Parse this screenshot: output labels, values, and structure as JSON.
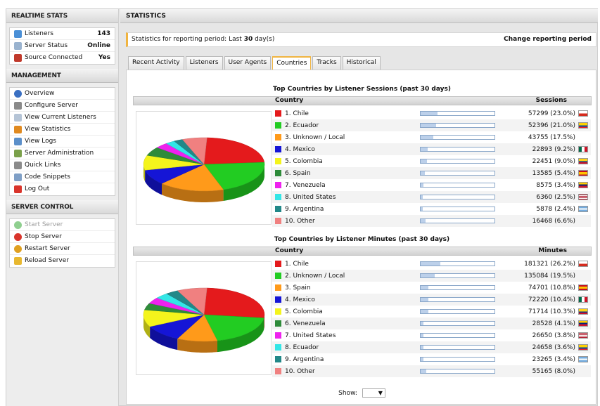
{
  "left": {
    "realtime": {
      "title": "REALTIME STATS",
      "rows": [
        {
          "label": "Listeners",
          "value": "143",
          "icon": "users-icon",
          "color": "#4a8fd6"
        },
        {
          "label": "Server Status",
          "value": "Online",
          "icon": "server-status-icon",
          "color": "#9ab3cf"
        },
        {
          "label": "Source Connected",
          "value": "Yes",
          "icon": "speaker-icon",
          "color": "#c0392b"
        }
      ]
    },
    "management": {
      "title": "MANAGEMENT",
      "items": [
        {
          "label": "Overview",
          "icon": "info-icon",
          "color": "#3a6fc2"
        },
        {
          "label": "Configure Server",
          "icon": "gear-icon",
          "color": "#8a8a8a"
        },
        {
          "label": "View Current Listeners",
          "icon": "document-icon",
          "color": "#b5c4d6"
        },
        {
          "label": "View Statistics",
          "icon": "pie-chart-icon",
          "color": "#e08a20"
        },
        {
          "label": "View Logs",
          "icon": "log-magnifier-icon",
          "color": "#5b8fc9"
        },
        {
          "label": "Server Administration",
          "icon": "admin-icon",
          "color": "#7aa04a"
        },
        {
          "label": "Quick Links",
          "icon": "links-icon",
          "color": "#8b8b8b"
        },
        {
          "label": "Code Snippets",
          "icon": "snippet-icon",
          "color": "#7f9fc6"
        },
        {
          "label": "Log Out",
          "icon": "logout-x-icon",
          "color": "#d9342b"
        }
      ]
    },
    "control": {
      "title": "SERVER CONTROL",
      "items": [
        {
          "label": "Start Server",
          "icon": "play-icon",
          "color": "#8fcf8f",
          "disabled": true
        },
        {
          "label": "Stop Server",
          "icon": "stop-icon",
          "color": "#d9342b"
        },
        {
          "label": "Restart Server",
          "icon": "restart-icon",
          "color": "#e0a020"
        },
        {
          "label": "Reload Server",
          "icon": "reload-lightning-icon",
          "color": "#e8b830"
        }
      ]
    }
  },
  "main": {
    "title": "STATISTICS",
    "period": {
      "prefix": "Statistics for reporting period: Last ",
      "days": "30",
      "suffix": " day(s)",
      "change": "Change reporting period"
    },
    "tabs": [
      "Recent Activity",
      "Listeners",
      "User Agents",
      "Countries",
      "Tracks",
      "Historical"
    ],
    "active_tab": "Countries",
    "sessions": {
      "title": "Top Countries by Listener Sessions (past 30 days)",
      "col_country": "Country",
      "col_value": "Sessions",
      "rows": [
        {
          "name": "1. Chile",
          "value": "57299 (23.0%)",
          "pct": 23.0,
          "color": "#e41a1c",
          "flag": "chile"
        },
        {
          "name": "2. Ecuador",
          "value": "52396 (21.0%)",
          "pct": 21.0,
          "color": "#22cc22",
          "flag": "ecuador"
        },
        {
          "name": "3. Unknown / Local",
          "value": "43755 (17.5%)",
          "pct": 17.5,
          "color": "#ff9a1a",
          "flag": ""
        },
        {
          "name": "4. Mexico",
          "value": "22893 (9.2%)",
          "pct": 9.2,
          "color": "#1515d6",
          "flag": "mexico"
        },
        {
          "name": "5. Colombia",
          "value": "22451 (9.0%)",
          "pct": 9.0,
          "color": "#f4f41c",
          "flag": "colombia"
        },
        {
          "name": "6. Spain",
          "value": "13585 (5.4%)",
          "pct": 5.4,
          "color": "#2e8b3a",
          "flag": "spain"
        },
        {
          "name": "7. Venezuela",
          "value": "8575 (3.4%)",
          "pct": 3.4,
          "color": "#ee22ee",
          "flag": "venezuela"
        },
        {
          "name": "8. United States",
          "value": "6360 (2.5%)",
          "pct": 2.5,
          "color": "#33e6e6",
          "flag": "usa"
        },
        {
          "name": "9. Argentina",
          "value": "5878 (2.4%)",
          "pct": 2.4,
          "color": "#228888",
          "flag": "argentina"
        },
        {
          "name": "10. Other",
          "value": "16468 (6.6%)",
          "pct": 6.6,
          "color": "#f08080",
          "flag": ""
        }
      ]
    },
    "minutes": {
      "title": "Top Countries by Listener Minutes (past 30 days)",
      "col_country": "Country",
      "col_value": "Minutes",
      "rows": [
        {
          "name": "1. Chile",
          "value": "181321 (26.2%)",
          "pct": 26.2,
          "color": "#e41a1c",
          "flag": "chile"
        },
        {
          "name": "2. Unknown / Local",
          "value": "135084 (19.5%)",
          "pct": 19.5,
          "color": "#22cc22",
          "flag": ""
        },
        {
          "name": "3. Spain",
          "value": "74701 (10.8%)",
          "pct": 10.8,
          "color": "#ff9a1a",
          "flag": "spain"
        },
        {
          "name": "4. Mexico",
          "value": "72220 (10.4%)",
          "pct": 10.4,
          "color": "#1515d6",
          "flag": "mexico"
        },
        {
          "name": "5. Colombia",
          "value": "71714 (10.3%)",
          "pct": 10.3,
          "color": "#f4f41c",
          "flag": "colombia"
        },
        {
          "name": "6. Venezuela",
          "value": "28528 (4.1%)",
          "pct": 4.1,
          "color": "#2e8b3a",
          "flag": "venezuela"
        },
        {
          "name": "7. United States",
          "value": "26650 (3.8%)",
          "pct": 3.8,
          "color": "#ee22ee",
          "flag": "usa"
        },
        {
          "name": "8. Ecuador",
          "value": "24658 (3.6%)",
          "pct": 3.6,
          "color": "#33e6e6",
          "flag": "ecuador"
        },
        {
          "name": "9. Argentina",
          "value": "23265 (3.4%)",
          "pct": 3.4,
          "color": "#228888",
          "flag": "argentina"
        },
        {
          "name": "10. Other",
          "value": "55165 (8.0%)",
          "pct": 8.0,
          "color": "#f08080",
          "flag": ""
        }
      ]
    },
    "show_label": "Show:"
  }
}
